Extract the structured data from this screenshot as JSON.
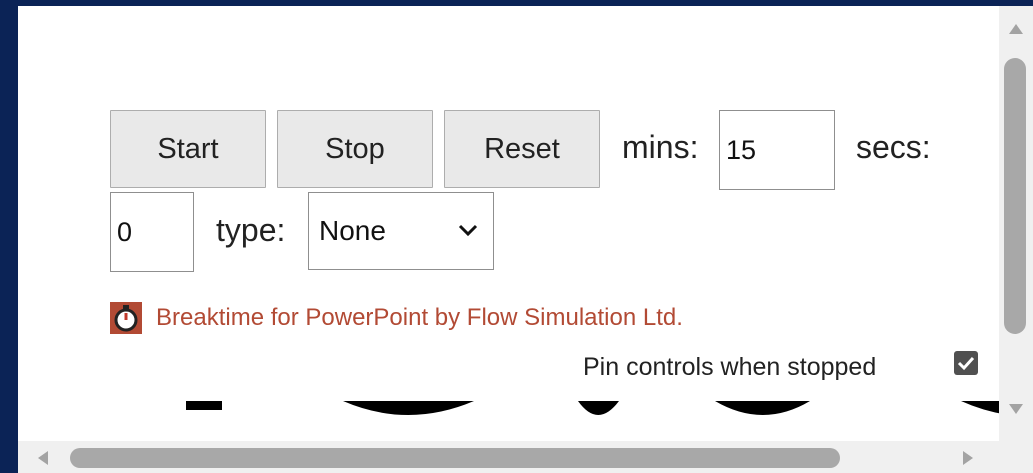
{
  "controls": {
    "start_label": "Start",
    "stop_label": "Stop",
    "reset_label": "Reset",
    "mins_label": "mins:",
    "mins_value": "15",
    "secs_label": "secs:",
    "secs_value": "0",
    "type_label": "type:",
    "type_selected": "None"
  },
  "branding": {
    "text": "Breaktime for PowerPoint by Flow Simulation Ltd.",
    "icon": "stopwatch-icon",
    "text_color": "#b24a34"
  },
  "pin": {
    "label": "Pin controls when stopped",
    "checked": true
  },
  "colors": {
    "outer_background": "#0b2356",
    "button_background": "#e9e9e9"
  }
}
